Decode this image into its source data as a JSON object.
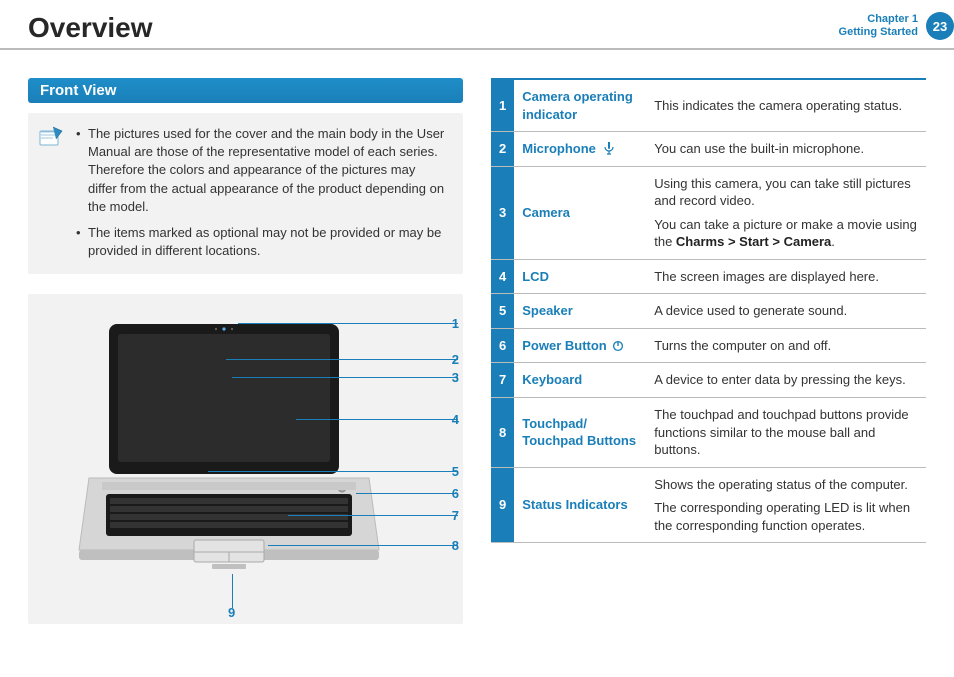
{
  "header": {
    "title": "Overview",
    "chapter_num": "Chapter 1",
    "chapter_title": "Getting Started",
    "page_number": "23"
  },
  "section_title": "Front View",
  "notes": [
    "The pictures used for the cover and the main body in the User Manual are those of the representative model of each series. Therefore the colors and appearance of the pictures may differ from the actual appearance of the product depending on the model.",
    "The items marked as optional may not be provided or may be provided in different locations."
  ],
  "callouts": [
    "1",
    "2",
    "3",
    "4",
    "5",
    "6",
    "7",
    "8",
    "9"
  ],
  "parts": [
    {
      "num": "1",
      "name": "Camera operating indicator",
      "icon": "",
      "desc": [
        "This indicates the camera operating status."
      ]
    },
    {
      "num": "2",
      "name": "Microphone",
      "icon": "mic",
      "desc": [
        "You can use the built-in microphone."
      ]
    },
    {
      "num": "3",
      "name": "Camera",
      "icon": "",
      "desc": [
        "Using this camera, you can take still pictures and record video.",
        "You can take a picture or make a movie using the <b>Charms > Start > Camera</b>."
      ]
    },
    {
      "num": "4",
      "name": "LCD",
      "icon": "",
      "desc": [
        "The screen images are displayed here."
      ]
    },
    {
      "num": "5",
      "name": "Speaker",
      "icon": "",
      "desc": [
        "A device used to generate sound."
      ]
    },
    {
      "num": "6",
      "name": "Power Button",
      "icon": "power",
      "desc": [
        "Turns the computer on and off."
      ]
    },
    {
      "num": "7",
      "name": "Keyboard",
      "icon": "",
      "desc": [
        "A device to enter data by pressing the keys."
      ]
    },
    {
      "num": "8",
      "name": "Touchpad/ Touchpad Buttons",
      "icon": "",
      "desc": [
        "The touchpad and touchpad buttons provide functions similar to the mouse ball and buttons."
      ]
    },
    {
      "num": "9",
      "name": "Status Indicators",
      "icon": "",
      "desc": [
        "Shows the operating status of the computer.",
        "The corresponding operating LED is lit when the corresponding function operates."
      ]
    }
  ]
}
